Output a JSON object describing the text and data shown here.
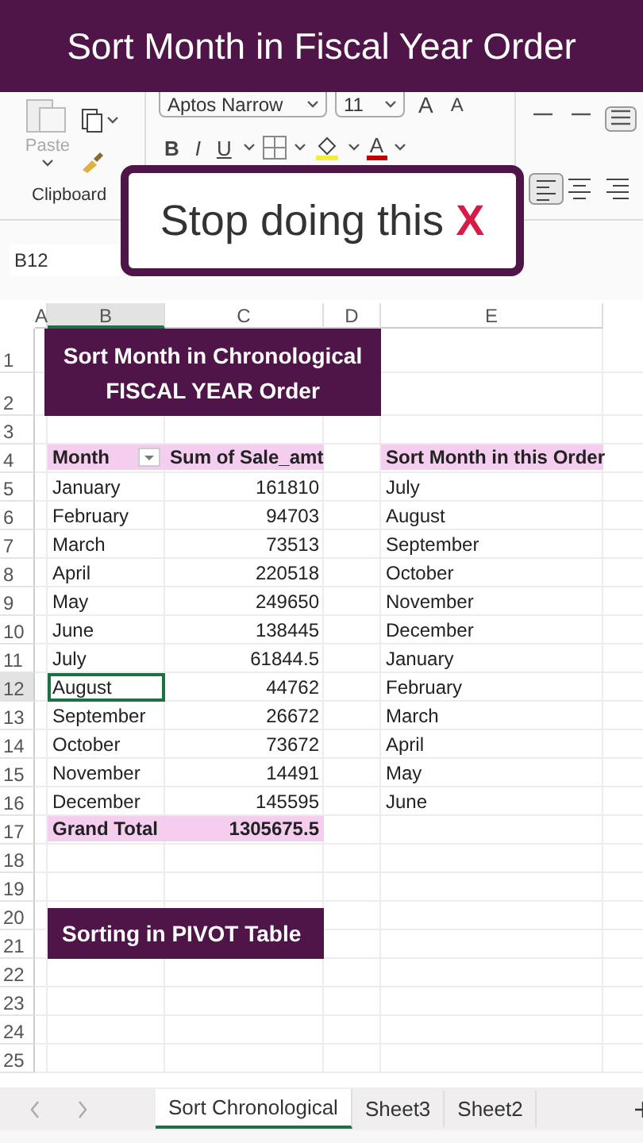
{
  "banner": {
    "title": "Sort Month in Fiscal Year Order"
  },
  "ribbon": {
    "paste": "Paste",
    "clipboard_label": "Clipboard",
    "font_name": "Aptos Narrow",
    "font_size": "11",
    "size_buttons": [
      "A",
      "A"
    ],
    "style_buttons": [
      "B",
      "I",
      "U"
    ],
    "font_color": "A"
  },
  "callout": {
    "text": "Stop doing this",
    "mark": "X"
  },
  "name_box": "B12",
  "columns": [
    {
      "label": "A",
      "selected": false
    },
    {
      "label": "B",
      "selected": true
    },
    {
      "label": "C",
      "selected": false
    },
    {
      "label": "D",
      "selected": false
    },
    {
      "label": "E",
      "selected": false
    }
  ],
  "rows": [
    {
      "label": "1",
      "selected": false
    },
    {
      "label": "2",
      "selected": false
    },
    {
      "label": "3",
      "selected": false
    },
    {
      "label": "4",
      "selected": false
    },
    {
      "label": "5",
      "selected": false
    },
    {
      "label": "6",
      "selected": false
    },
    {
      "label": "7",
      "selected": false
    },
    {
      "label": "8",
      "selected": false
    },
    {
      "label": "9",
      "selected": false
    },
    {
      "label": "10",
      "selected": false
    },
    {
      "label": "11",
      "selected": false
    },
    {
      "label": "12",
      "selected": true
    },
    {
      "label": "13",
      "selected": false
    },
    {
      "label": "14",
      "selected": false
    },
    {
      "label": "15",
      "selected": false
    },
    {
      "label": "16",
      "selected": false
    },
    {
      "label": "17",
      "selected": false
    },
    {
      "label": "18",
      "selected": false
    },
    {
      "label": "19",
      "selected": false
    },
    {
      "label": "20",
      "selected": false
    },
    {
      "label": "21",
      "selected": false
    },
    {
      "label": "22",
      "selected": false
    },
    {
      "label": "23",
      "selected": false
    },
    {
      "label": "24",
      "selected": false
    },
    {
      "label": "25",
      "selected": false
    }
  ],
  "title_block": {
    "lines": [
      "Sort Month in Chronological",
      "FISCAL YEAR Order"
    ]
  },
  "pivot": {
    "columns": [
      "Month",
      "Sum of Sale_amt"
    ],
    "rows": [
      {
        "month": "January",
        "sum": "161810",
        "selected": false
      },
      {
        "month": "February",
        "sum": "94703",
        "selected": false
      },
      {
        "month": "March",
        "sum": "73513",
        "selected": false
      },
      {
        "month": "April",
        "sum": "220518",
        "selected": false
      },
      {
        "month": "May",
        "sum": "249650",
        "selected": false
      },
      {
        "month": "June",
        "sum": "138445",
        "selected": false
      },
      {
        "month": "July",
        "sum": "61844.5",
        "selected": false
      },
      {
        "month": "August",
        "sum": "44762",
        "selected": true
      },
      {
        "month": "September",
        "sum": "26672",
        "selected": false
      },
      {
        "month": "October",
        "sum": "73672",
        "selected": false
      },
      {
        "month": "November",
        "sum": "14491",
        "selected": false
      },
      {
        "month": "December",
        "sum": "145595",
        "selected": false
      }
    ],
    "total": {
      "label": "Grand Total",
      "value": "1305675.5"
    }
  },
  "order_list": {
    "header": "Sort Month in this Order",
    "items": [
      "July",
      "August",
      "September",
      "October",
      "November",
      "December",
      "January",
      "February",
      "March",
      "April",
      "May",
      "June"
    ]
  },
  "pivot_label": "Sorting in PIVOT Table",
  "sheet_tabs": [
    {
      "label": "Sort Chronological",
      "selected": true
    },
    {
      "label": "Sheet3",
      "selected": false
    },
    {
      "label": "Sheet2",
      "selected": false
    }
  ]
}
